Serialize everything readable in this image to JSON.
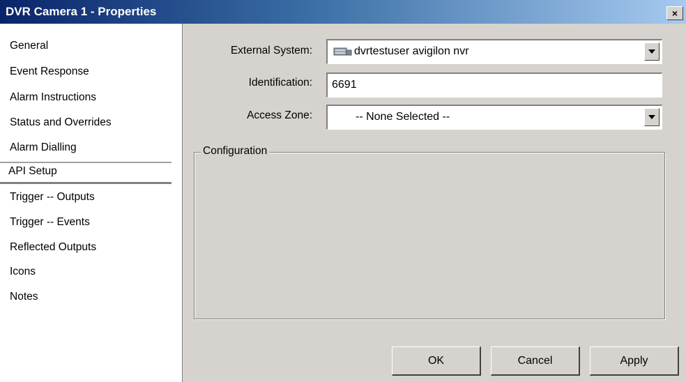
{
  "window": {
    "title": "DVR Camera 1 - Properties",
    "close_label": "×"
  },
  "sidebar": {
    "items": [
      {
        "label": "General"
      },
      {
        "label": "Event Response"
      },
      {
        "label": "Alarm Instructions"
      },
      {
        "label": "Status and Overrides"
      },
      {
        "label": "Alarm Dialling"
      },
      {
        "label": "API Setup"
      },
      {
        "label": "Trigger -- Outputs"
      },
      {
        "label": "Trigger -- Events"
      },
      {
        "label": "Reflected Outputs"
      },
      {
        "label": "Icons"
      },
      {
        "label": "Notes"
      }
    ],
    "selected": "API Setup"
  },
  "form": {
    "external_system": {
      "label": "External System:",
      "value": "dvrtestuser avigilon nvr",
      "icon": "server-icon"
    },
    "identification": {
      "label": "Identification:",
      "value": "6691"
    },
    "access_zone": {
      "label": "Access Zone:",
      "value": "-- None Selected --"
    }
  },
  "configuration": {
    "title": "Configuration"
  },
  "buttons": {
    "ok": "OK",
    "cancel": "Cancel",
    "apply": "Apply"
  }
}
